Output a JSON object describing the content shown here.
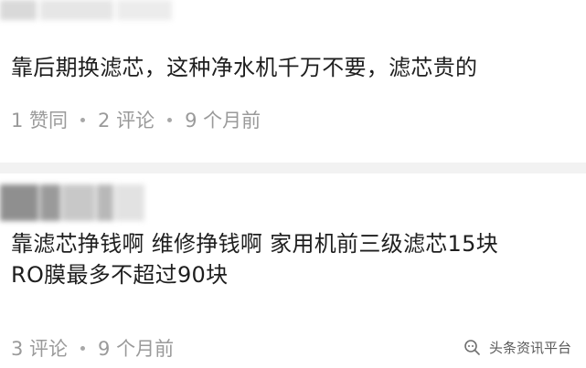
{
  "comments": [
    {
      "text": "靠后期换滤芯，这种净水机千万不要，滤芯贵的",
      "likes": "1 赞同",
      "replies": "2 评论",
      "time": "9 个月前"
    },
    {
      "text": "靠滤芯挣钱啊 维修挣钱啊 家用机前三级滤芯15块\nRO膜最多不超过90块",
      "replies": "3 评论",
      "time": "9 个月前"
    }
  ],
  "watermark": {
    "label": "头条资讯平台",
    "icon": "wechat-search-icon"
  },
  "colors": {
    "text": "#1e1e1e",
    "meta": "#9a9a9a",
    "separator": "#f2f2f2"
  }
}
